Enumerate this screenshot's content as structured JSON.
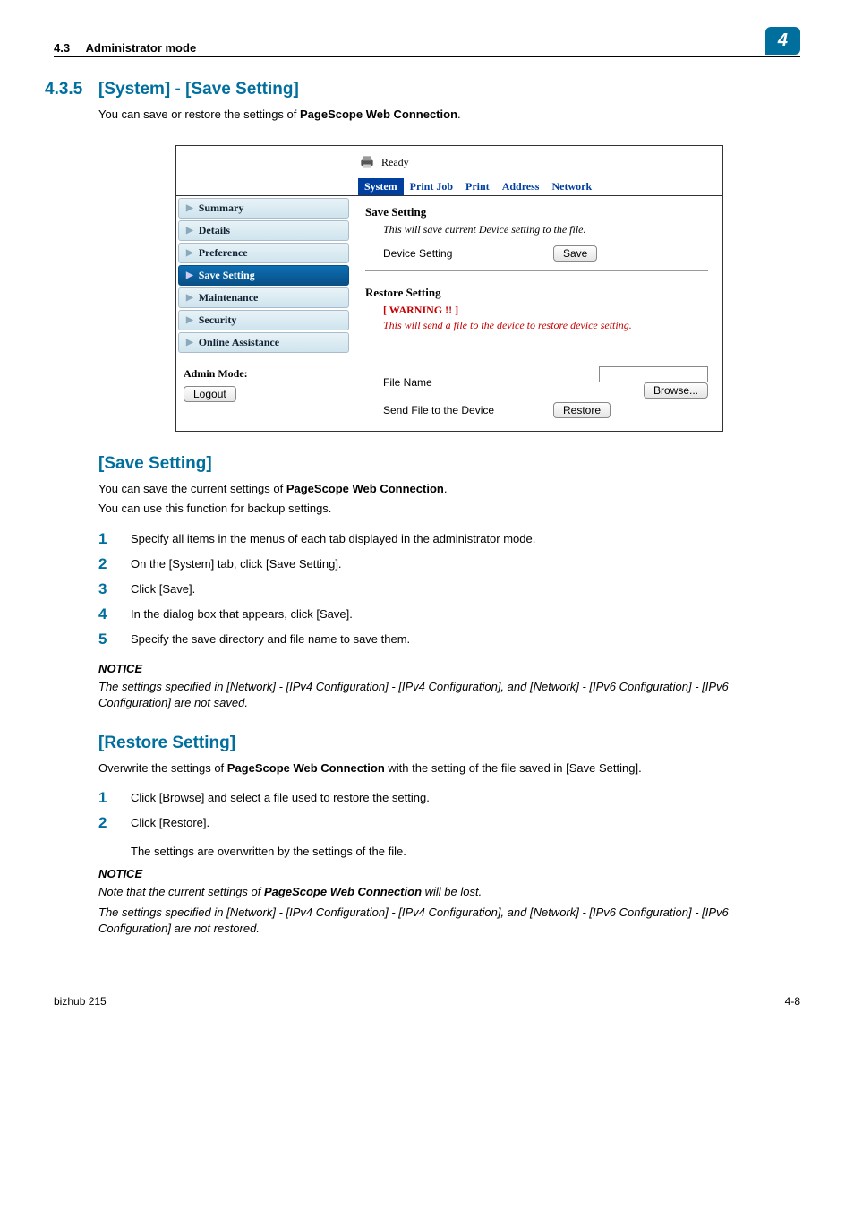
{
  "header": {
    "section_ref": "4.3",
    "section_title": "Administrator mode",
    "chapter_badge": "4"
  },
  "section_heading": {
    "number": "4.3.5",
    "title": "[System] - [Save Setting]"
  },
  "intro_text_prefix": "You can save or restore the settings of ",
  "intro_text_bold": "PageScope Web Connection",
  "intro_text_suffix": ".",
  "screenshot": {
    "status": "Ready",
    "tabs": [
      "System",
      "Print Job",
      "Print",
      "Address",
      "Network"
    ],
    "active_tab_index": 0,
    "sidebar": [
      "Summary",
      "Details",
      "Preference",
      "Save Setting",
      "Maintenance",
      "Security",
      "Online Assistance"
    ],
    "sidebar_active_index": 3,
    "admin_mode_label": "Admin Mode:",
    "logout_label": "Logout",
    "save_section_title": "Save Setting",
    "save_desc": "This will save current Device setting to the file.",
    "save_row_label": "Device Setting",
    "save_button": "Save",
    "restore_section_title": "Restore Setting",
    "warning_label": "[ WARNING !! ]",
    "warning_text": "This will send a file to the device to restore device setting.",
    "file_name_label": "File Name",
    "browse_button": "Browse...",
    "send_file_label": "Send File to the Device",
    "restore_button": "Restore"
  },
  "save_setting_section": {
    "title": "[Save Setting]",
    "intro_prefix": "You can save the current settings of ",
    "intro_bold": "PageScope Web Connection",
    "intro_suffix": ".",
    "backup_text": "You can use this function for backup settings.",
    "steps": [
      "Specify all items in the menus of each tab displayed in the administrator mode.",
      "On the [System] tab, click [Save Setting].",
      "Click [Save].",
      "In the dialog box that appears, click [Save].",
      "Specify the save directory and file name to save them."
    ],
    "notice_title": "NOTICE",
    "notice_text": "The settings specified in [Network] - [IPv4 Configuration] - [IPv4 Configuration], and [Network] - [IPv6 Configuration] - [IPv6 Configuration] are not saved."
  },
  "restore_setting_section": {
    "title": "[Restore Setting]",
    "intro_prefix": "Overwrite the settings of ",
    "intro_bold": "PageScope Web Connection",
    "intro_suffix": " with the setting of the file saved in [Save Setting].",
    "steps": [
      "Click [Browse] and select a file used to restore the setting.",
      "Click [Restore]."
    ],
    "substep": "The settings are overwritten by the settings of the file.",
    "notice_title": "NOTICE",
    "notice_para1_prefix": "Note that the current settings of ",
    "notice_para1_bold": "PageScope Web Connection",
    "notice_para1_suffix": " will be lost.",
    "notice_para2": "The settings specified in [Network] - [IPv4 Configuration] - [IPv4 Configuration], and [Network] - [IPv6 Configuration] - [IPv6 Configuration] are not restored."
  },
  "footer": {
    "left": "bizhub 215",
    "right": "4-8"
  }
}
